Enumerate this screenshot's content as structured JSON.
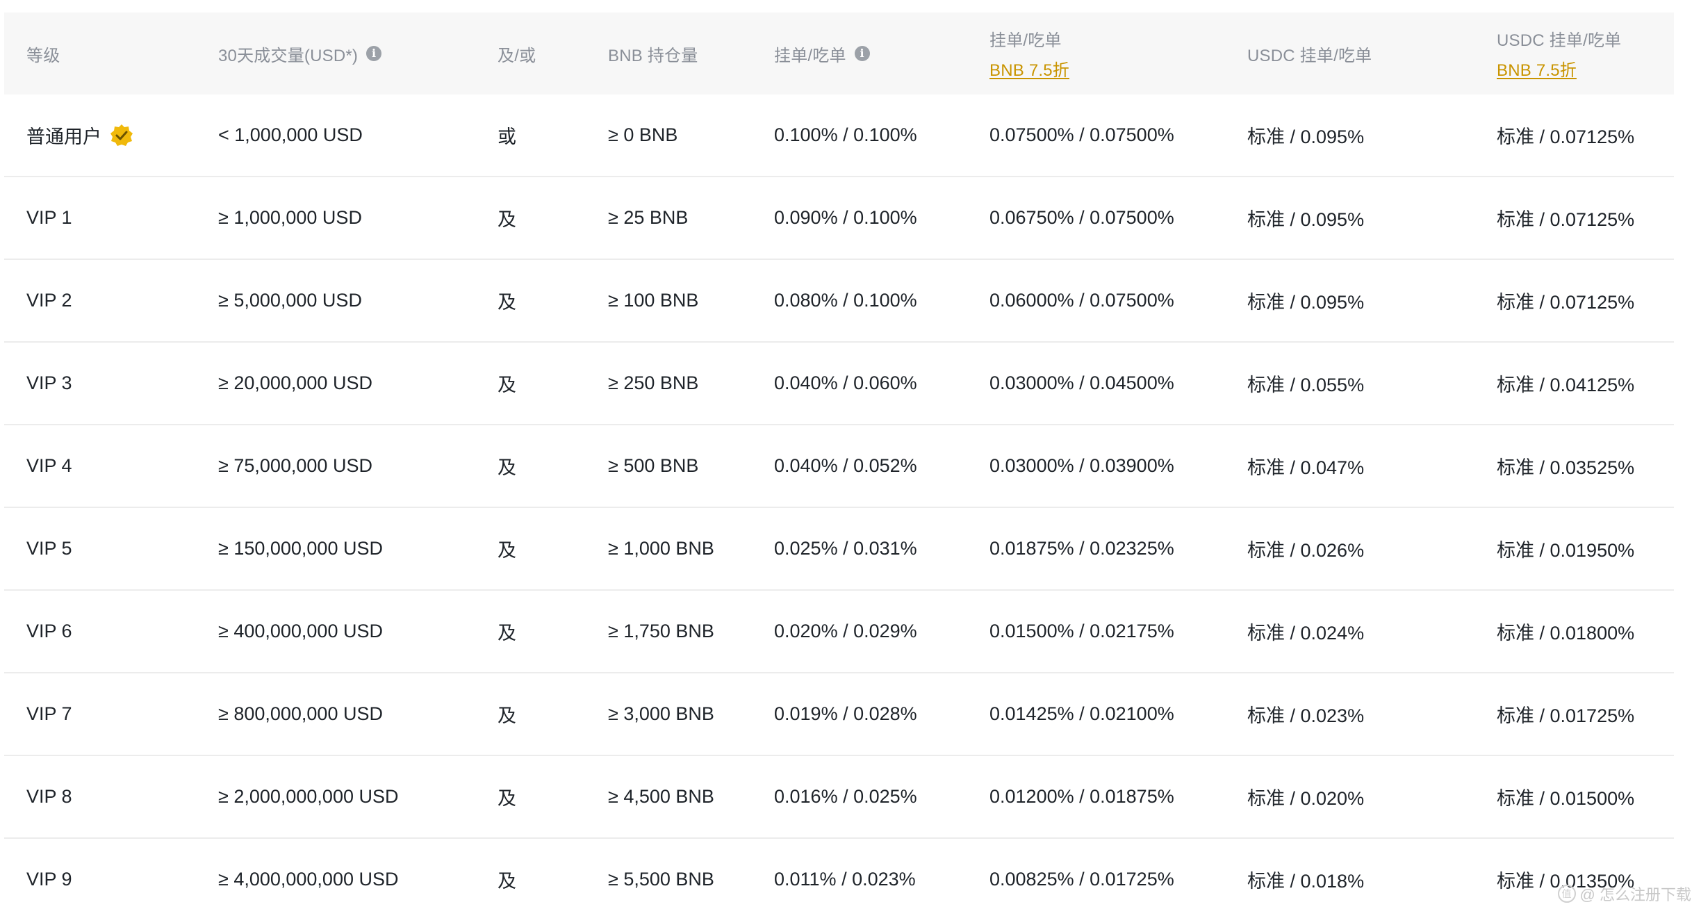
{
  "header": {
    "level": "等级",
    "volume": "30天成交量(USD*)",
    "andor": "及/或",
    "bnb_holding": "BNB 持仓量",
    "maker_taker": "挂单/吃单",
    "maker_taker_bnb": "挂单/吃单",
    "maker_taker_bnb_sub": "BNB 7.5折",
    "usdc_maker_taker": "USDC 挂单/吃单",
    "usdc_maker_taker_bnb": "USDC 挂单/吃单",
    "usdc_maker_taker_bnb_sub": "BNB 7.5折"
  },
  "rows": [
    {
      "level": "普通用户",
      "volume": "< 1,000,000 USD",
      "andor": "或",
      "bnb": "≥ 0 BNB",
      "mt": "0.100% / 0.100%",
      "mt_bnb": "0.07500% / 0.07500%",
      "usdc": "标准 / 0.095%",
      "usdc_bnb": "标准 / 0.07125%"
    },
    {
      "level": "VIP 1",
      "volume": "≥ 1,000,000 USD",
      "andor": "及",
      "bnb": "≥ 25 BNB",
      "mt": "0.090% / 0.100%",
      "mt_bnb": "0.06750% / 0.07500%",
      "usdc": "标准 / 0.095%",
      "usdc_bnb": "标准 / 0.07125%"
    },
    {
      "level": "VIP 2",
      "volume": "≥ 5,000,000 USD",
      "andor": "及",
      "bnb": "≥ 100 BNB",
      "mt": "0.080% / 0.100%",
      "mt_bnb": "0.06000% / 0.07500%",
      "usdc": "标准 / 0.095%",
      "usdc_bnb": "标准 / 0.07125%"
    },
    {
      "level": "VIP 3",
      "volume": "≥ 20,000,000 USD",
      "andor": "及",
      "bnb": "≥ 250 BNB",
      "mt": "0.040% / 0.060%",
      "mt_bnb": "0.03000% / 0.04500%",
      "usdc": "标准 / 0.055%",
      "usdc_bnb": "标准 / 0.04125%"
    },
    {
      "level": "VIP 4",
      "volume": "≥ 75,000,000 USD",
      "andor": "及",
      "bnb": "≥ 500 BNB",
      "mt": "0.040% / 0.052%",
      "mt_bnb": "0.03000% / 0.03900%",
      "usdc": "标准 / 0.047%",
      "usdc_bnb": "标准 / 0.03525%"
    },
    {
      "level": "VIP 5",
      "volume": "≥ 150,000,000 USD",
      "andor": "及",
      "bnb": "≥ 1,000 BNB",
      "mt": "0.025% / 0.031%",
      "mt_bnb": "0.01875% / 0.02325%",
      "usdc": "标准 / 0.026%",
      "usdc_bnb": "标准 / 0.01950%"
    },
    {
      "level": "VIP 6",
      "volume": "≥ 400,000,000 USD",
      "andor": "及",
      "bnb": "≥ 1,750 BNB",
      "mt": "0.020% / 0.029%",
      "mt_bnb": "0.01500% / 0.02175%",
      "usdc": "标准 / 0.024%",
      "usdc_bnb": "标准 / 0.01800%"
    },
    {
      "level": "VIP 7",
      "volume": "≥ 800,000,000 USD",
      "andor": "及",
      "bnb": "≥ 3,000 BNB",
      "mt": "0.019% / 0.028%",
      "mt_bnb": "0.01425% / 0.02100%",
      "usdc": "标准 / 0.023%",
      "usdc_bnb": "标准 / 0.01725%"
    },
    {
      "level": "VIP 8",
      "volume": "≥ 2,000,000,000 USD",
      "andor": "及",
      "bnb": "≥ 4,500 BNB",
      "mt": "0.016% / 0.025%",
      "mt_bnb": "0.01200% / 0.01875%",
      "usdc": "标准 / 0.020%",
      "usdc_bnb": "标准 / 0.01500%"
    },
    {
      "level": "VIP 9",
      "volume": "≥ 4,000,000,000 USD",
      "andor": "及",
      "bnb": "≥ 5,500 BNB",
      "mt": "0.011% / 0.023%",
      "mt_bnb": "0.00825% / 0.01725%",
      "usdc": "标准 / 0.018%",
      "usdc_bnb": "标准 / 0.01350%"
    }
  ],
  "icons": {
    "info": "info-icon",
    "verified": "verified-badge-icon"
  },
  "colors": {
    "accent": "#c99400",
    "badge": "#f0b90b",
    "header_bg": "#f7f7f7"
  },
  "watermark": {
    "text": "@ 怎么注册下载"
  }
}
